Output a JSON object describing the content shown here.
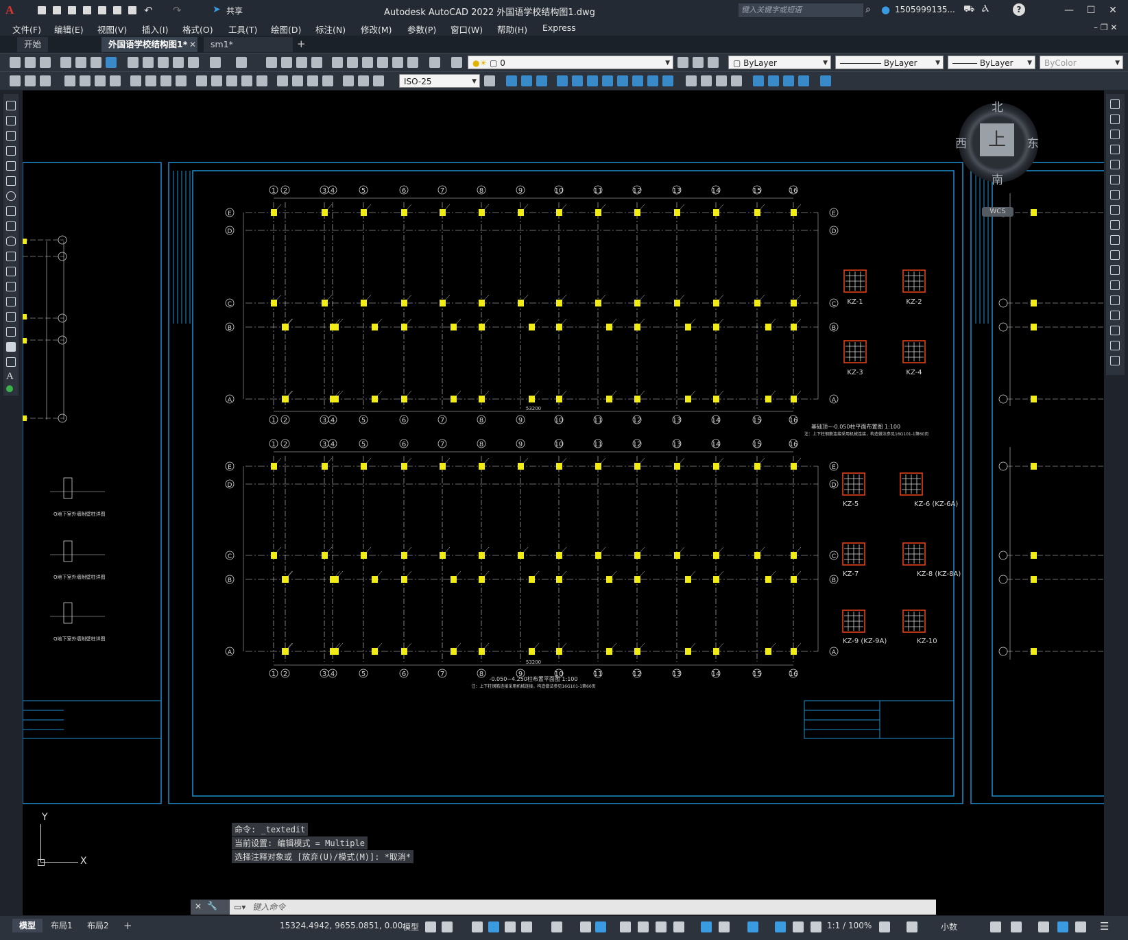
{
  "app": {
    "title": "Autodesk AutoCAD 2022    外国语学校结构图1.dwg",
    "search_placeholder": "键入关键字或短语",
    "user": "1505999135...",
    "share_label": "共享"
  },
  "menu": [
    "文件(F)",
    "编辑(E)",
    "视图(V)",
    "插入(I)",
    "格式(O)",
    "工具(T)",
    "绘图(D)",
    "标注(N)",
    "修改(M)",
    "参数(P)",
    "窗口(W)",
    "帮助(H)",
    "Express"
  ],
  "tabs": [
    {
      "label": "开始",
      "active": false
    },
    {
      "label": "外国语学校结构图1*",
      "active": true
    },
    {
      "label": "sm1*",
      "active": false
    }
  ],
  "toolbar": {
    "layer_value": "0",
    "color_value": "ByLayer",
    "linetype_value": "ByLayer",
    "lineweight_value": "ByLayer",
    "plotstyle_value": "ByColor",
    "dimstyle_value": "ISO-25"
  },
  "viewcube": {
    "north": "北",
    "south": "南",
    "east": "东",
    "west": "西",
    "top": "上",
    "wcs": "WCS"
  },
  "drawing": {
    "grid_numbers": [
      "1",
      "2",
      "3",
      "4",
      "5",
      "6",
      "7",
      "8",
      "9",
      "10",
      "11",
      "12",
      "13",
      "14",
      "15",
      "16"
    ],
    "grid_letters": [
      "E",
      "D",
      "C",
      "B",
      "A"
    ],
    "plan1_title": "基础顶~-0.050柱平面布置图 1:100",
    "plan1_note": "注：上下柱钢筋连接采用机械连接，构造做法参见16G101-1第60页",
    "plan2_title": "-0.050~4.250柱布置平面图 1:100",
    "plan2_note": "注：上下柱钢筋连接采用机械连接，构造做法参见16G101-1第60页",
    "total_dim": "53200",
    "columns_set1": [
      "KZ-1",
      "KZ-2",
      "KZ-3",
      "KZ-4"
    ],
    "columns_set2": [
      "KZ-5",
      "KZ-6 (KZ-6A)",
      "KZ-7",
      "KZ-8 (KZ-8A)",
      "KZ-9 (KZ-9A)",
      "KZ-10"
    ],
    "left_details": [
      "Q地下室外墙附壁柱详图",
      "Q地下室外墙附壁柱详图",
      "Q地下室外墙附壁柱详图"
    ]
  },
  "command": {
    "history": [
      "命令: _textedit",
      "当前设置: 编辑模式 = Multiple",
      "选择注释对象或 [放弃(U)/模式(M)]: *取消*"
    ],
    "input_placeholder": "键入命令"
  },
  "ucs": {
    "x": "X",
    "y": "Y"
  },
  "status": {
    "layout_tabs": [
      {
        "label": "模型",
        "active": true
      },
      {
        "label": "布局1",
        "active": false
      },
      {
        "label": "布局2",
        "active": false
      }
    ],
    "coordinates": "15324.4942, 9655.0851, 0.00...",
    "mode": "模型",
    "scale": "1:1 / 100%",
    "units": "小数"
  }
}
